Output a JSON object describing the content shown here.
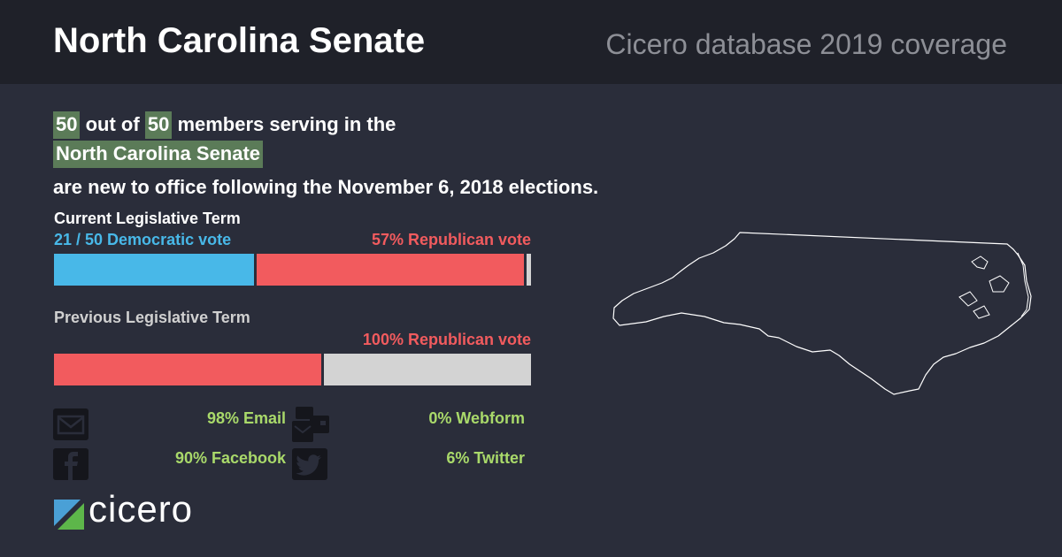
{
  "header": {
    "title": "North Carolina Senate",
    "subtitle": "Cicero database 2019 coverage"
  },
  "summary": {
    "new_count": "50",
    "total_count": "50",
    "text_out_of": "out of",
    "text_members": "members serving in the",
    "chamber": "North Carolina Senate",
    "text_following": "are new to office following the November 6, 2018 elections."
  },
  "current_term": {
    "label": "Current Legislative Term",
    "dem_label": "21 / 50 Democratic vote",
    "rep_label": "57% Republican vote",
    "dem_seats": 21,
    "rep_seats": 28,
    "other_seats": 1,
    "total_seats": 50
  },
  "previous_term": {
    "label": "Previous Legislative Term",
    "rep_label": "100% Republican vote",
    "rep_fraction": 0.56,
    "rest_fraction": 0.44
  },
  "contact": {
    "email": {
      "icon": "envelope-icon",
      "label": "98% Email"
    },
    "webform": {
      "icon": "webform-icon",
      "label": "0% Webform"
    },
    "facebook": {
      "icon": "facebook-icon",
      "label": "90% Facebook"
    },
    "twitter": {
      "icon": "twitter-icon",
      "label": "6% Twitter"
    }
  },
  "logo": {
    "text": "cicero"
  },
  "colors": {
    "democratic": "#48b8e8",
    "republican": "#f25b5e",
    "neutral": "#d3d3d3",
    "highlight": "#5b7b58",
    "stat_green": "#a9d96a",
    "background": "#2a2d3a",
    "header_bg": "#1f2129"
  }
}
